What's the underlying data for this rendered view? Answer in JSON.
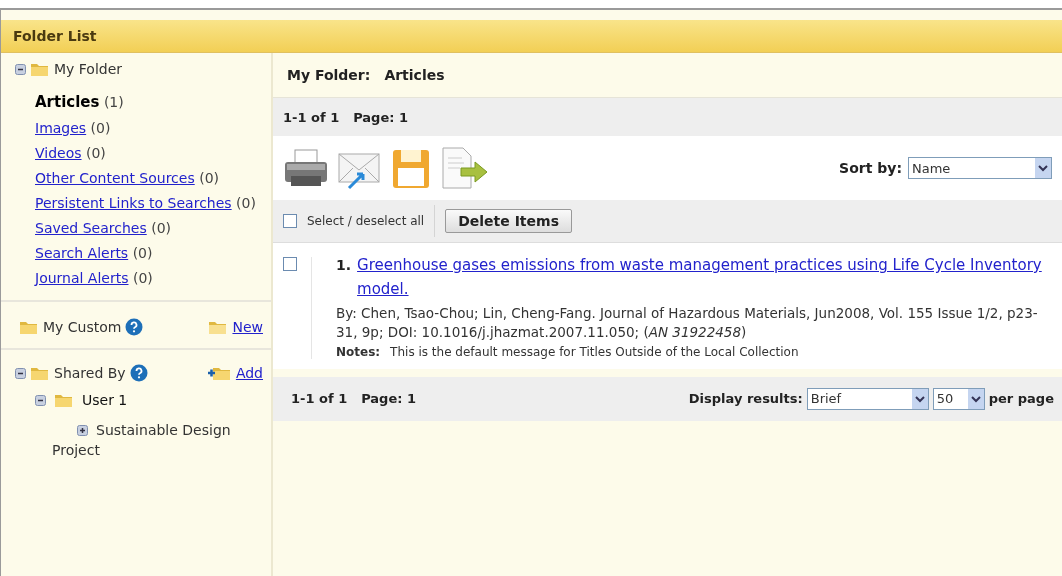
{
  "header": {
    "title": "Folder List"
  },
  "sidebar": {
    "my_folder": {
      "label": "My Folder",
      "expanded": true,
      "items": [
        {
          "label": "Articles",
          "count": "(1)",
          "selected": true
        },
        {
          "label": "Images",
          "count": "(0)",
          "selected": false
        },
        {
          "label": "Videos",
          "count": "(0)",
          "selected": false
        },
        {
          "label": "Other Content Sources",
          "count": "(0)",
          "selected": false
        },
        {
          "label": "Persistent Links to Searches",
          "count": "(0)",
          "selected": false
        },
        {
          "label": "Saved Searches",
          "count": "(0)",
          "selected": false
        },
        {
          "label": "Search Alerts",
          "count": "(0)",
          "selected": false
        },
        {
          "label": "Journal Alerts",
          "count": "(0)",
          "selected": false
        }
      ]
    },
    "my_custom": {
      "label": "My Custom",
      "action": "New"
    },
    "shared_by": {
      "label": "Shared By",
      "action": "Add",
      "expanded": true,
      "children": [
        {
          "label": "User 1",
          "expanded": true,
          "children": [
            {
              "label": "Sustainable Design Project",
              "expanded": false
            }
          ]
        }
      ]
    }
  },
  "content": {
    "breadcrumb": {
      "label": "My Folder:",
      "value": "Articles"
    },
    "pager_top": {
      "range": "1-1 of 1",
      "page": "Page: 1"
    },
    "sort": {
      "label": "Sort by:",
      "value": "Name"
    },
    "select_all": {
      "label": "Select / deselect all",
      "checked": false
    },
    "delete_button": "Delete Items",
    "results": [
      {
        "number": "1.",
        "title": "Greenhouse gases emissions from waste management practices using Life Cycle Inventory model.",
        "citation": "By: Chen, Tsao-Chou; Lin, Cheng-Fang. Journal of Hazardous Materials, Jun2008, Vol. 155 Issue 1/2, p23-31, 9p; DOI: 10.1016/j.jhazmat.2007.11.050; (*AN 31922458*)",
        "notes_label": "Notes:",
        "notes": "This is the default message for Titles Outside of the Local Collection",
        "checked": false
      }
    ],
    "pager_bottom": {
      "range": "1-1 of 1",
      "page": "Page: 1"
    },
    "display": {
      "label": "Display results:",
      "format": "Brief",
      "per_page": "50",
      "suffix": "per page"
    }
  }
}
